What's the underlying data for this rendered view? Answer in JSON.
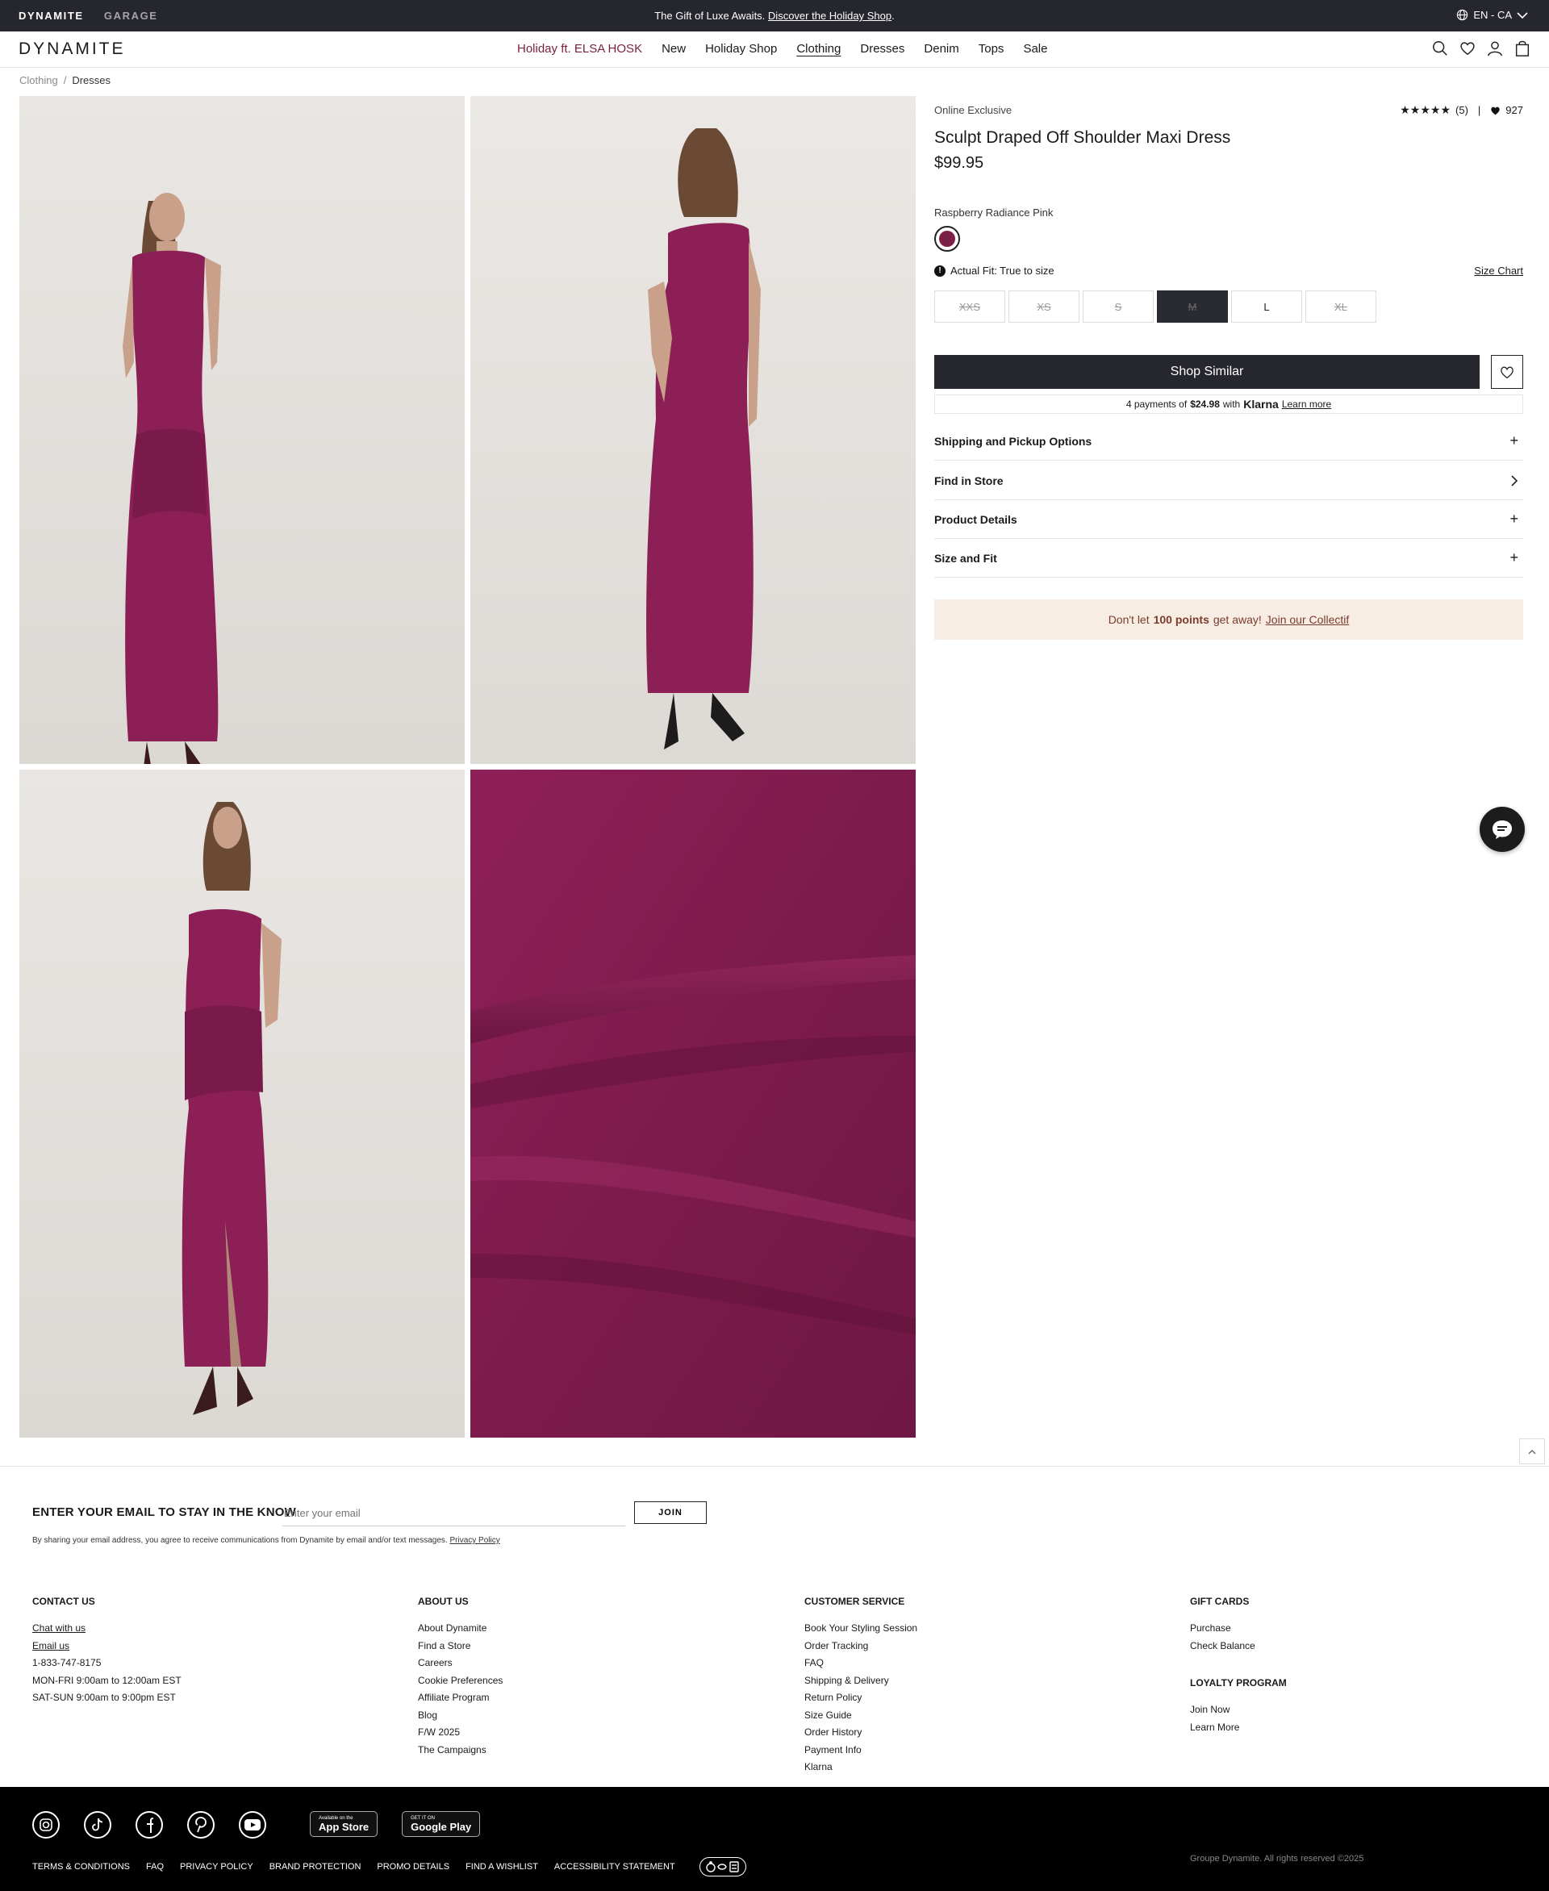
{
  "topbar": {
    "brand_1": "DYNAMITE",
    "brand_2": "GARAGE",
    "promo_text": "The Gift of Luxe Awaits.",
    "promo_link": "Discover the Holiday Shop",
    "promo_end": ".",
    "language": "EN - CA"
  },
  "header": {
    "logo": "DYNAMITE",
    "nav": [
      "Holiday ft. ELSA HOSK",
      "New",
      "Holiday Shop",
      "Clothing",
      "Dresses",
      "Denim",
      "Tops",
      "Sale"
    ]
  },
  "breadcrumb": {
    "parent": "Clothing",
    "separator": "/",
    "current": "Dresses"
  },
  "product": {
    "tag": "Online Exclusive",
    "stars": "★★★★★",
    "review_count": "(5)",
    "divider": "|",
    "wishlist_count": "927",
    "title": "Sculpt Draped Off Shoulder Maxi Dress",
    "price": "$99.95",
    "color_name": "Raspberry Radiance Pink",
    "swatch_color": "#7d2047",
    "fit_text": "Actual Fit: True to size",
    "size_chart": "Size Chart",
    "sizes": [
      {
        "label": "XXS",
        "state": "unavailable"
      },
      {
        "label": "XS",
        "state": "unavailable"
      },
      {
        "label": "S",
        "state": "unavailable"
      },
      {
        "label": "M",
        "state": "selected-unavailable"
      },
      {
        "label": "L",
        "state": "available"
      },
      {
        "label": "XL",
        "state": "unavailable"
      }
    ],
    "shop_similar": "Shop Similar",
    "klarna": {
      "prefix": "4 payments of",
      "amount": "$24.98",
      "with": "with",
      "brand": "Klarna",
      "learn_more": "Learn more"
    },
    "accordions": [
      {
        "label": "Shipping and Pickup Options",
        "icon": "plus-icon"
      },
      {
        "label": "Find in Store",
        "icon": "chevron-right-icon"
      },
      {
        "label": "Product Details",
        "icon": "plus-icon"
      },
      {
        "label": "Size and Fit",
        "icon": "plus-icon"
      }
    ],
    "loyalty": {
      "prefix": "Don't let",
      "points": "100 points",
      "middle": "get away!",
      "link": "Join our Collectif"
    }
  },
  "footer": {
    "newsletter_heading": "ENTER YOUR EMAIL TO STAY IN THE KNOW",
    "email_placeholder": "Enter your email",
    "join": "JOIN",
    "consent": "By sharing your email address, you agree to receive communications from Dynamite by email and/or text messages.",
    "privacy_link": "Privacy Policy",
    "contact": {
      "title": "CONTACT US",
      "items": [
        "Chat with us",
        "Email us",
        "1-833-747-8175",
        "MON-FRI 9:00am to 12:00am EST",
        "SAT-SUN 9:00am to 9:00pm EST"
      ]
    },
    "about": {
      "title": "ABOUT US",
      "items": [
        "About Dynamite",
        "Find a Store",
        "Careers",
        "Cookie Preferences",
        "Affiliate Program",
        "Blog",
        "F/W 2025",
        "The Campaigns"
      ]
    },
    "service": {
      "title": "CUSTOMER SERVICE",
      "items": [
        "Book Your Styling Session",
        "Order Tracking",
        "FAQ",
        "Shipping & Delivery",
        "Return Policy",
        "Size Guide",
        "Order History",
        "Payment Info",
        "Klarna"
      ]
    },
    "gift": {
      "title": "GIFT CARDS",
      "items": [
        "Purchase",
        "Check Balance"
      ]
    },
    "loyalty": {
      "title": "LOYALTY PROGRAM",
      "items": [
        "Join Now",
        "Learn More"
      ]
    },
    "app_store": {
      "small": "Available on the",
      "large": "App Store"
    },
    "google_play": {
      "small": "GET IT ON",
      "large": "Google Play"
    },
    "legal": [
      "TERMS & CONDITIONS",
      "FAQ",
      "PRIVACY POLICY",
      "BRAND PROTECTION",
      "PROMO DETAILS",
      "FIND A WISHLIST",
      "ACCESSIBILITY STATEMENT"
    ],
    "copyright": "Groupe Dynamite. All rights reserved ©2025"
  }
}
